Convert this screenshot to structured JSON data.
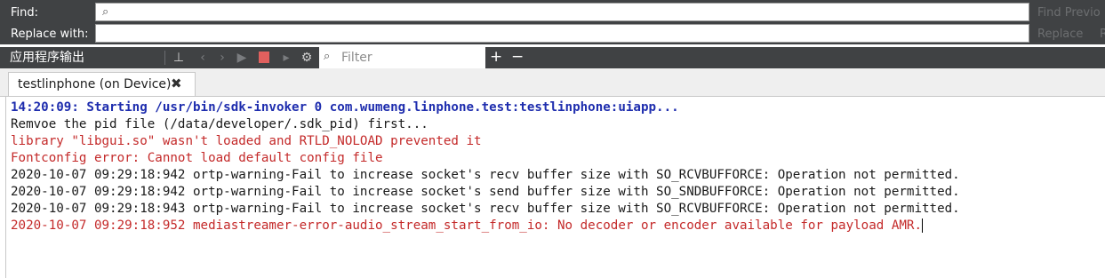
{
  "find_replace": {
    "find_label": "Find:",
    "replace_label": "Replace with:",
    "find_value": "",
    "replace_value": "",
    "find_previous_label": "Find Previo",
    "replace_button_label": "Replace",
    "replace_all_label": "R"
  },
  "output_pane": {
    "title": "应用程序输出",
    "filter_placeholder": "Filter",
    "add_label": "+",
    "remove_label": "−"
  },
  "tabs": [
    {
      "label": "testlinphone (on Device)"
    }
  ],
  "output_lines": [
    {
      "text": "14:20:09: Starting /usr/bin/sdk-invoker 0 com.wumeng.linphone.test:testlinphone:uiapp...",
      "style": "blue"
    },
    {
      "text": "Remvoe the pid file (/data/developer/.sdk_pid) first...",
      "style": "black"
    },
    {
      "text": "library \"libgui.so\" wasn't loaded and RTLD_NOLOAD prevented it",
      "style": "red"
    },
    {
      "text": "Fontconfig error: Cannot load default config file",
      "style": "red"
    },
    {
      "text": "2020-10-07 09:29:18:942 ortp-warning-Fail to increase socket's recv buffer size with SO_RCVBUFFORCE: Operation not permitted.",
      "style": "black"
    },
    {
      "text": "2020-10-07 09:29:18:942 ortp-warning-Fail to increase socket's send buffer size with SO_SNDBUFFORCE: Operation not permitted.",
      "style": "black"
    },
    {
      "text": "2020-10-07 09:29:18:943 ortp-warning-Fail to increase socket's recv buffer size with SO_RCVBUFFORCE: Operation not permitted.",
      "style": "black"
    },
    {
      "text": "2020-10-07 09:29:18:952 mediastreamer-error-audio_stream_start_from_io: No decoder or encoder available for payload AMR.",
      "style": "red"
    }
  ],
  "colors": {
    "panel_bg": "#404244",
    "info_blue": "#1e2dae",
    "error_red": "#c42a2a",
    "stop_red": "#e0605e"
  },
  "icons": [
    "search-icon",
    "attach-to-process-icon",
    "previous-icon",
    "next-icon",
    "run-icon",
    "stop-icon",
    "step-icon",
    "settings-icon",
    "filter-search-icon",
    "close-tab-icon",
    "add-icon",
    "remove-icon"
  ]
}
